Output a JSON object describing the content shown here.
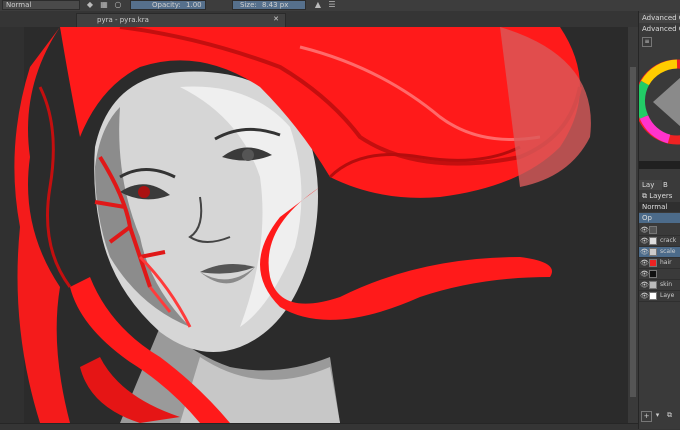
{
  "toolbar": {
    "blend_mode": "Normal",
    "opacity_label": "Opacity:",
    "opacity_value": "1.00",
    "size_label": "Size:",
    "size_value": "8.43 px"
  },
  "document_tab": {
    "title": "pyra - pyra.kra"
  },
  "dock": {
    "top_tab": "Advanced C...",
    "sub_tab": "Advanced C...",
    "bottom_tabs": [
      "Lay",
      "B"
    ],
    "layers_title": "Layers",
    "layers_blend": "Normal",
    "layers_opacity_short": "Op",
    "layers": [
      {
        "name": "",
        "selected": false
      },
      {
        "name": "crack",
        "selected": false
      },
      {
        "name": "scale",
        "selected": true
      },
      {
        "name": "hair",
        "selected": false
      },
      {
        "name": "",
        "selected": false
      },
      {
        "name": "skin",
        "selected": false
      },
      {
        "name": "Laye",
        "selected": false
      }
    ]
  },
  "colors": {
    "hair": "#ff1a1a",
    "background": "#262626",
    "ui_panel": "#3a3a3a",
    "selection": "#4c6b8a"
  }
}
